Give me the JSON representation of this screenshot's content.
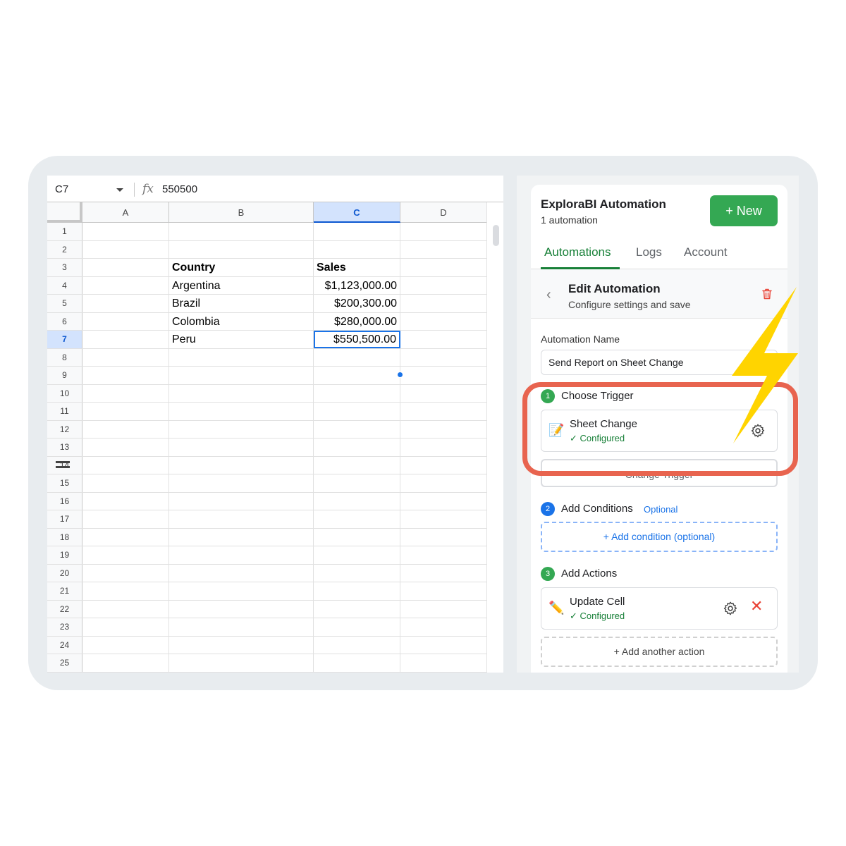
{
  "sheet": {
    "name_box": "C7",
    "fx_symbol": "fx",
    "formula_value": "550500",
    "columns": [
      "A",
      "B",
      "C",
      "D"
    ],
    "selected_column": "C",
    "rows": [
      {
        "n": "1",
        "b": "",
        "c": ""
      },
      {
        "n": "2",
        "b": "",
        "c": ""
      },
      {
        "n": "3",
        "b": "Country",
        "c": "Sales",
        "bold": true
      },
      {
        "n": "4",
        "b": "Argentina",
        "c": "$1,123,000.00"
      },
      {
        "n": "5",
        "b": "Brazil",
        "c": "$200,300.00"
      },
      {
        "n": "6",
        "b": "Colombia",
        "c": "$280,000.00"
      },
      {
        "n": "7",
        "b": "Peru",
        "c": "$550,500.00",
        "active": true
      },
      {
        "n": "8"
      },
      {
        "n": "9"
      },
      {
        "n": "10"
      },
      {
        "n": "11"
      },
      {
        "n": "12"
      },
      {
        "n": "13"
      },
      {
        "n": "14"
      },
      {
        "n": "15"
      },
      {
        "n": "16"
      },
      {
        "n": "17"
      },
      {
        "n": "18"
      },
      {
        "n": "19"
      },
      {
        "n": "20"
      },
      {
        "n": "21"
      },
      {
        "n": "22"
      },
      {
        "n": "23"
      },
      {
        "n": "24"
      },
      {
        "n": "25"
      }
    ]
  },
  "panel": {
    "app_title": "ExploraBI Automation",
    "automation_count": "1 automation",
    "new_button": "+ New",
    "tabs": [
      "Automations",
      "Logs",
      "Account"
    ],
    "active_tab": "Automations",
    "edit_title": "Edit Automation",
    "edit_subtitle": "Configure settings and save",
    "name_label": "Automation Name",
    "name_value": "Send Report on Sheet Change",
    "step1": {
      "num": "1",
      "label": "Choose Trigger"
    },
    "trigger_card": {
      "icon": "📝",
      "title": "Sheet Change",
      "status": "✓ Configured"
    },
    "change_trigger_button": "Change Trigger",
    "step2": {
      "num": "2",
      "label": "Add Conditions",
      "optional": "Optional"
    },
    "add_condition": "+ Add condition (optional)",
    "step3": {
      "num": "3",
      "label": "Add Actions"
    },
    "action_card": {
      "icon": "✏️",
      "title": "Update Cell",
      "status": "✓ Configured"
    },
    "add_action": "+ Add another action"
  },
  "colors": {
    "green": "#34a853",
    "blue": "#1a73e8",
    "highlight": "#e8644f",
    "bolt": "#ffd400",
    "danger": "#e94235"
  }
}
